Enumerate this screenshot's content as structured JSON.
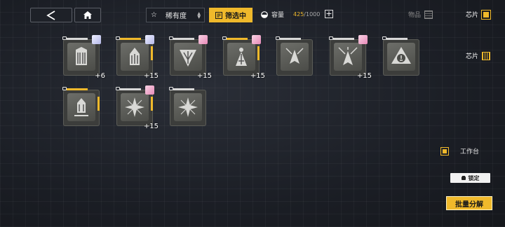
{
  "toolbar": {
    "sort_label": "稀有度",
    "filter_label": "筛选中",
    "capacity_label": "容量",
    "capacity_used": "425",
    "capacity_max": "/1000",
    "add_label": "+"
  },
  "tabs": {
    "items_label": "物品",
    "chips_label": "芯片",
    "chips_label_2": "芯片"
  },
  "grid": {
    "items": [
      {
        "level": "+6",
        "avatar": "blue"
      },
      {
        "level": "+15",
        "avatar": "blue"
      },
      {
        "level": "+15",
        "avatar": "pink"
      },
      {
        "level": "+15",
        "avatar": "pink"
      },
      {
        "level": "",
        "avatar": ""
      },
      {
        "level": "+15",
        "avatar": "pink"
      },
      {
        "level": "",
        "avatar": ""
      },
      {
        "level": "",
        "avatar": ""
      },
      {
        "level": "+15",
        "avatar": "pink"
      },
      {
        "level": "",
        "avatar": ""
      }
    ]
  },
  "side": {
    "workbench_label": "工作台",
    "lock_label": "锁定",
    "batch_label": "批量分解"
  },
  "colors": {
    "accent": "#f0b92b",
    "background": "#1b1e25"
  }
}
